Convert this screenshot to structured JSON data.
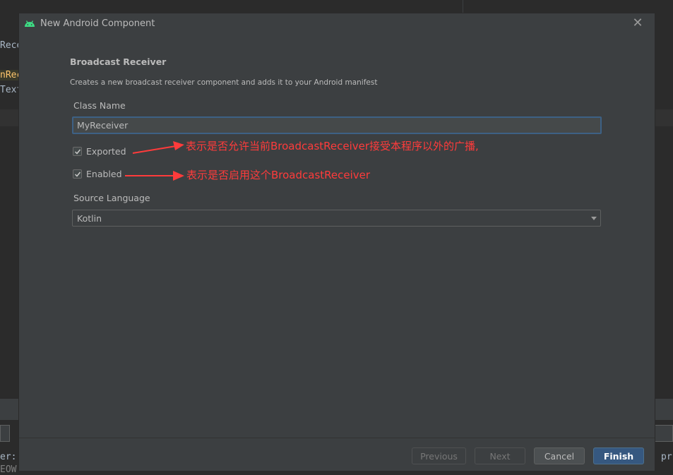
{
  "background": {
    "code_lines": [
      "Rece",
      "nRec",
      "Text"
    ],
    "bottom_left_text": "er:",
    "bottom_right_text": "pr",
    "bottom_last_line": "EOW"
  },
  "dialog": {
    "title": "New Android Component",
    "heading": "Broadcast Receiver",
    "description": "Creates a new broadcast receiver component and adds it to your Android manifest",
    "class_name_label": "Class Name",
    "class_name_value": "MyReceiver",
    "exported_label": "Exported",
    "exported_checked": true,
    "enabled_label": "Enabled",
    "enabled_checked": true,
    "source_language_label": "Source Language",
    "source_language_value": "Kotlin",
    "buttons": {
      "previous": "Previous",
      "next": "Next",
      "cancel": "Cancel",
      "finish": "Finish"
    }
  },
  "annotations": {
    "exported_note": "表示是否允许当前BroadcastReceiver接受本程序以外的广播,",
    "enabled_note": "表示是否启用这个BroadcastReceiver"
  },
  "colors": {
    "accent": "#365880",
    "annotation": "#ff3b3b",
    "android_green": "#3ddc84"
  }
}
